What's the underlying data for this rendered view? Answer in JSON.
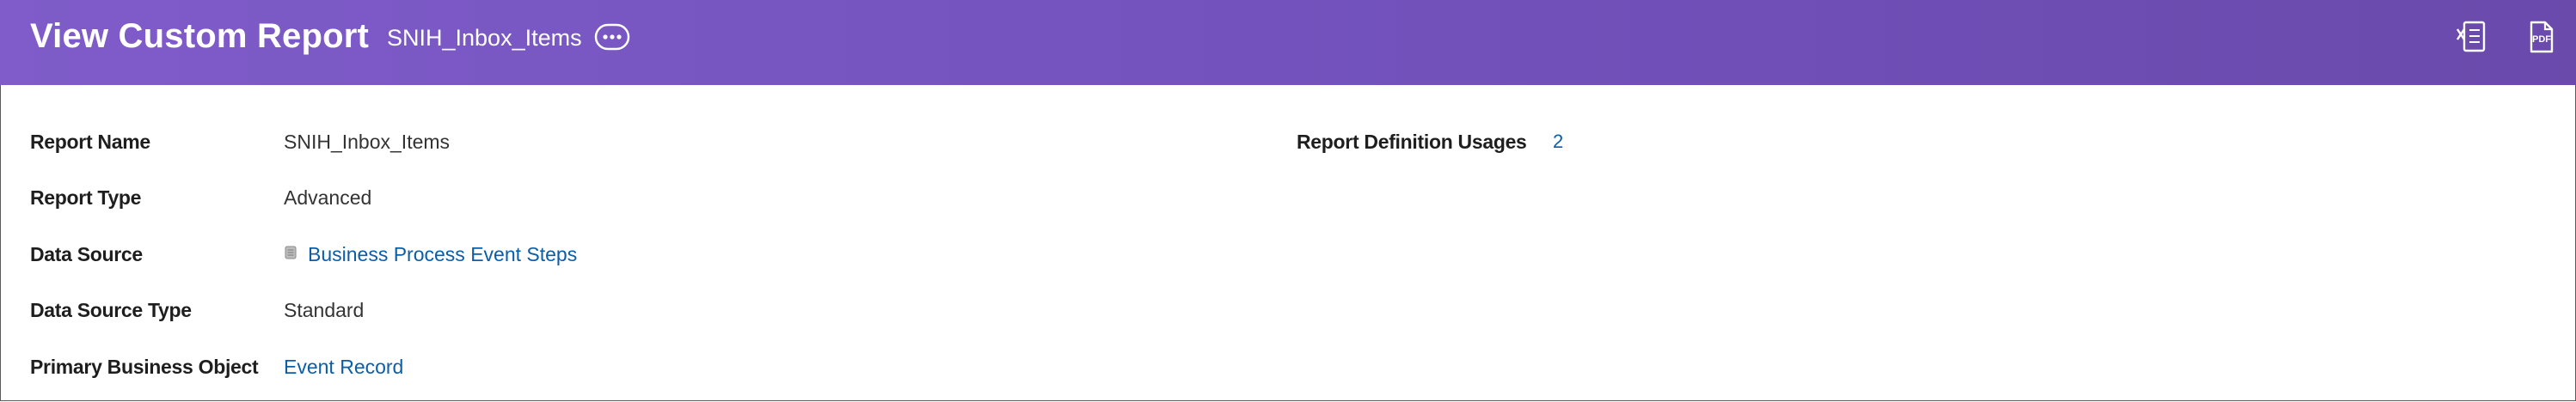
{
  "header": {
    "title": "View Custom Report",
    "report_name": "SNIH_Inbox_Items",
    "related_actions_icon": "ellipsis-circle-icon",
    "export_excel_icon": "excel-export-icon",
    "export_pdf_icon": "pdf-export-icon",
    "export_pdf_icon_text": "PDF",
    "color": "#7352bd"
  },
  "fields": {
    "report_name": {
      "label": "Report Name",
      "value": "SNIH_Inbox_Items"
    },
    "report_type": {
      "label": "Report Type",
      "value": "Advanced"
    },
    "data_source": {
      "label": "Data Source",
      "value": "Business Process Event Steps",
      "icon": "data-source-icon"
    },
    "data_source_type": {
      "label": "Data Source Type",
      "value": "Standard"
    },
    "primary_business_object": {
      "label": "Primary Business Object",
      "value": "Event Record"
    },
    "report_definition_usages": {
      "label": "Report Definition Usages",
      "value": "2"
    }
  },
  "colors": {
    "link": "#0b5ea8",
    "label": "#1e1e1e",
    "value": "#333333"
  }
}
